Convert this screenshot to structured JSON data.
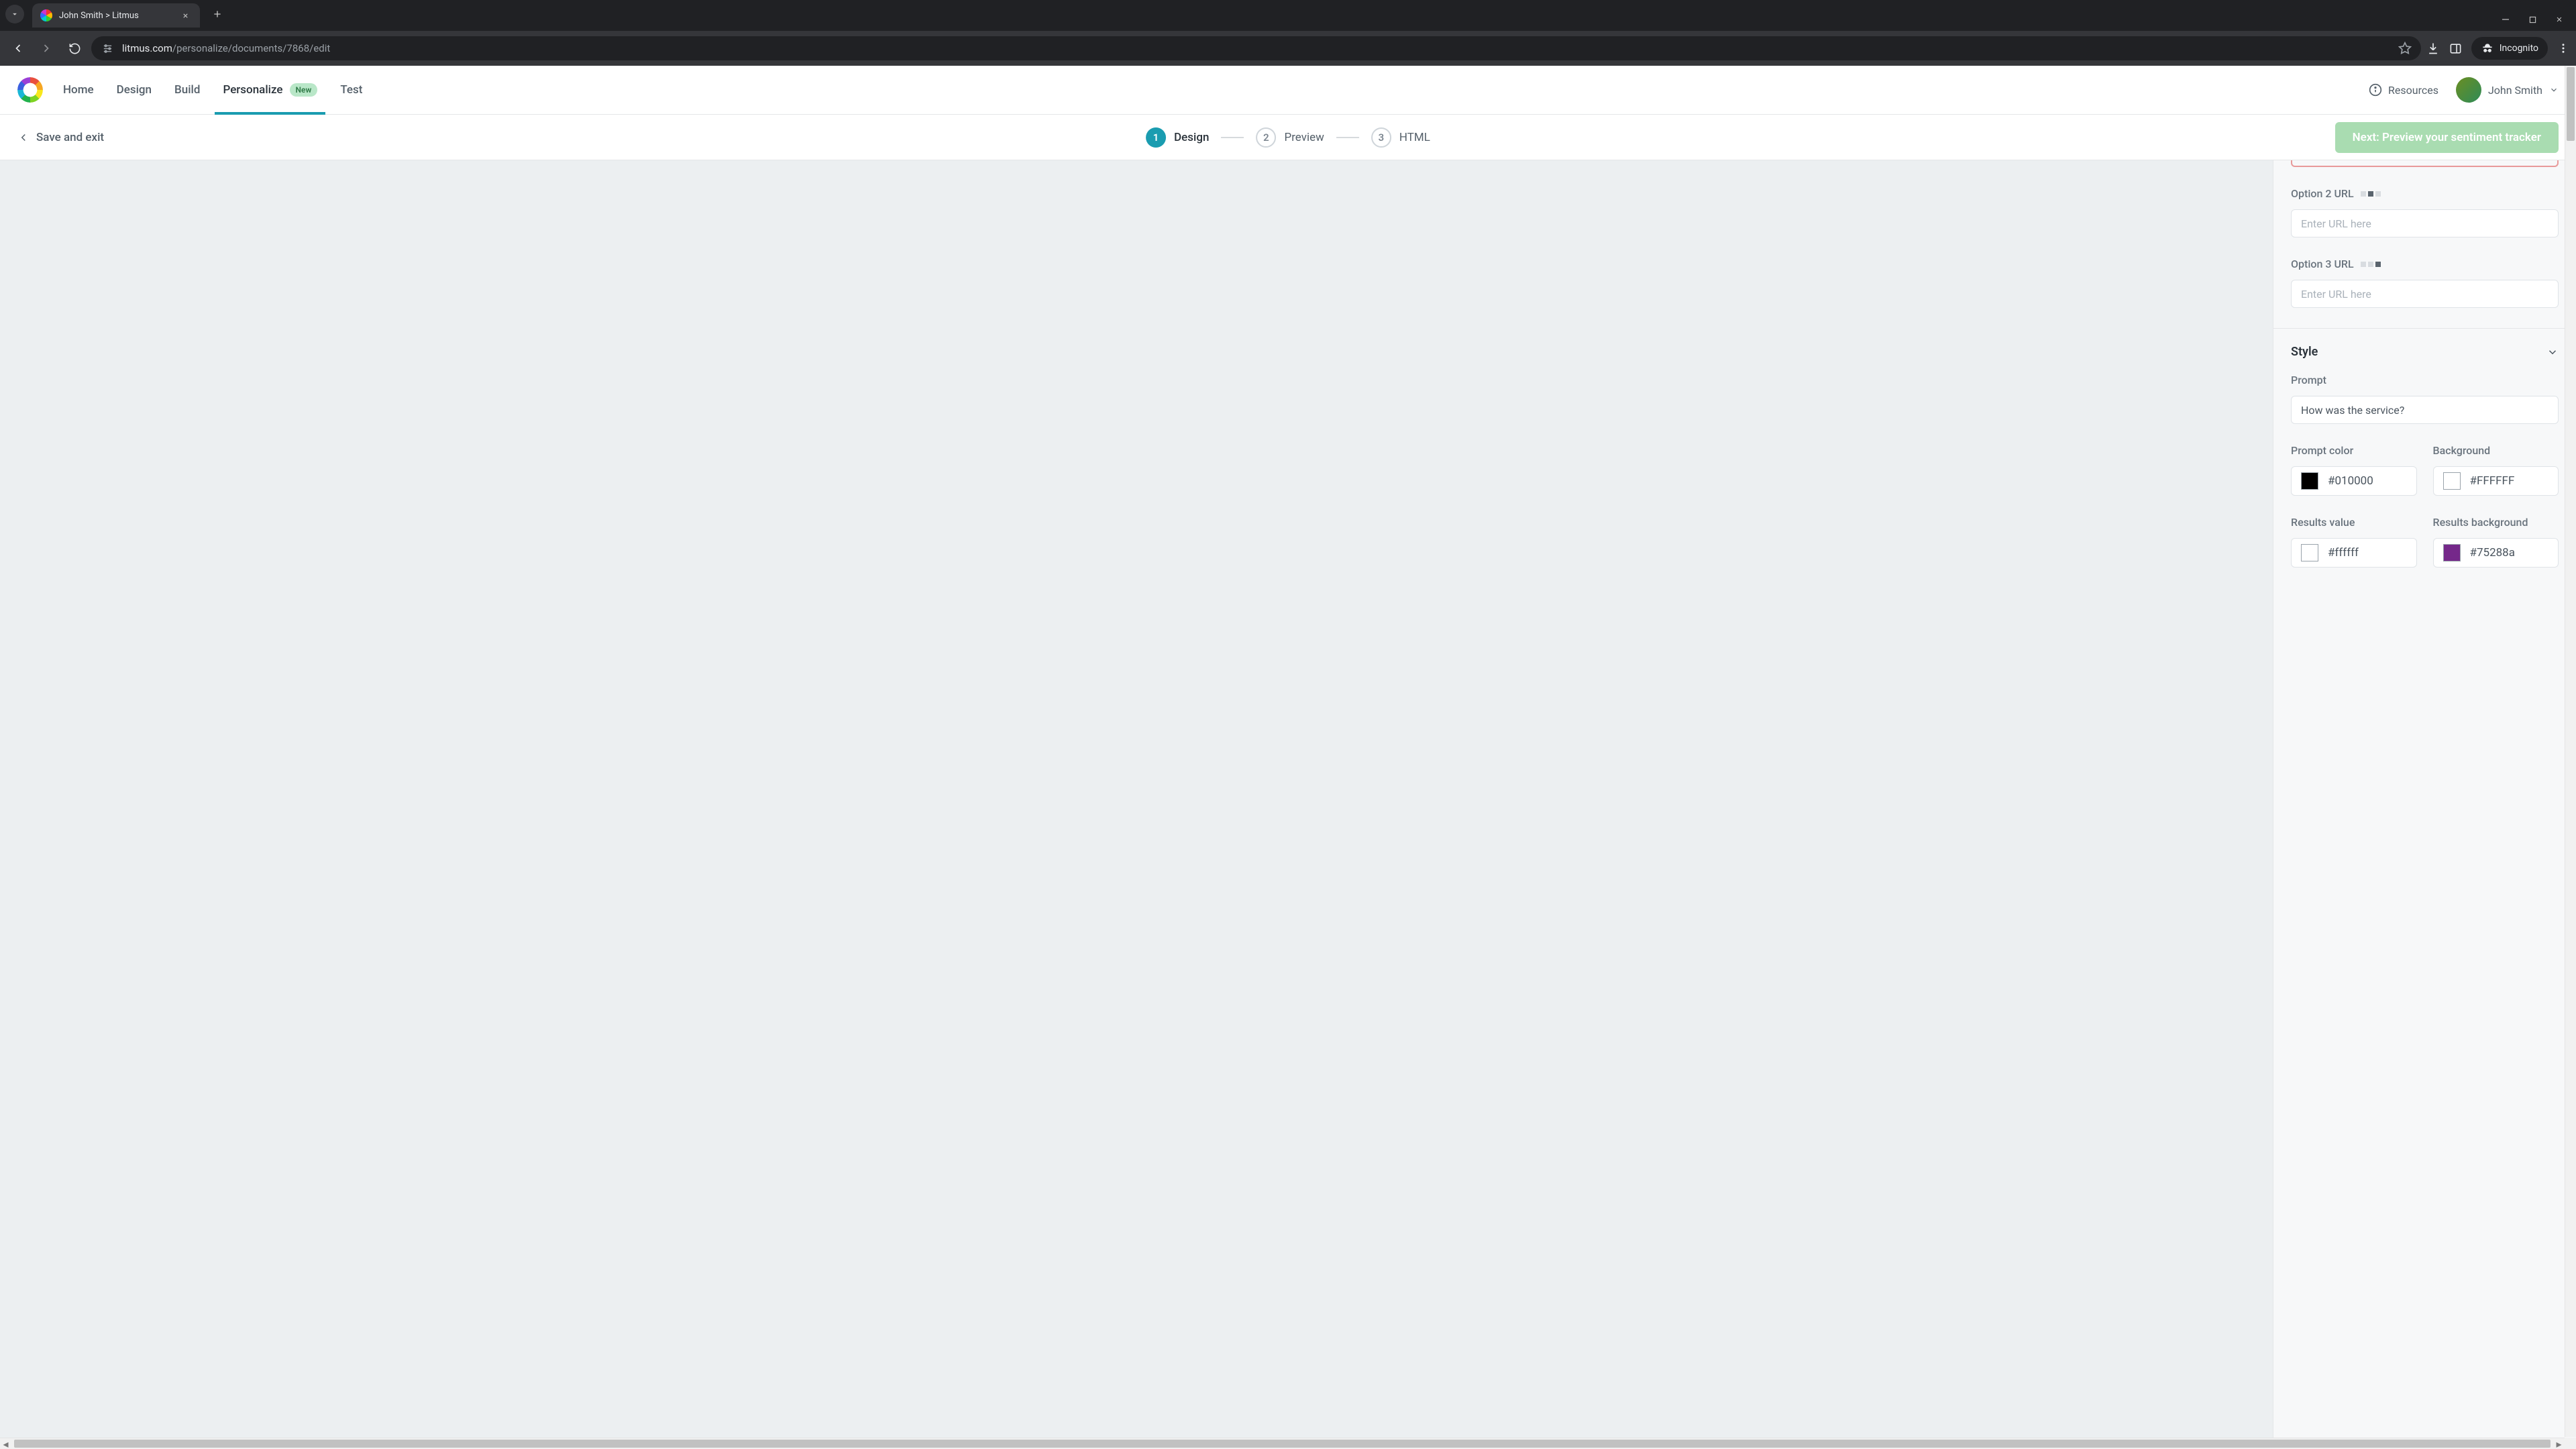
{
  "browser": {
    "tab_title": "John Smith > Litmus",
    "url_host": "litmus.com",
    "url_path": "/personalize/documents/7868/edit",
    "incognito": "Incognito"
  },
  "nav": {
    "home": "Home",
    "design": "Design",
    "build": "Build",
    "personalize": "Personalize",
    "personalize_badge": "New",
    "test": "Test",
    "resources": "Resources",
    "user": "John Smith"
  },
  "stepbar": {
    "save_exit": "Save and exit",
    "step1": "Design",
    "step2": "Preview",
    "step3": "HTML",
    "n1": "1",
    "n2": "2",
    "n3": "3",
    "next": "Next: Preview your sentiment tracker"
  },
  "panel": {
    "option2_label": "Option 2 URL",
    "option3_label": "Option 3 URL",
    "url_placeholder": "Enter URL here",
    "style_heading": "Style",
    "prompt_label": "Prompt",
    "prompt_value": "How was the service?",
    "prompt_color_label": "Prompt color",
    "prompt_color_value": "#010000",
    "background_label": "Background",
    "background_value": "#FFFFFF",
    "results_value_label": "Results value",
    "results_value_value": "#ffffff",
    "results_bg_label": "Results background",
    "results_bg_value": "#75288a",
    "colors": {
      "prompt": "#010000",
      "background": "#FFFFFF",
      "results_value": "#ffffff",
      "results_bg": "#75288a"
    }
  }
}
